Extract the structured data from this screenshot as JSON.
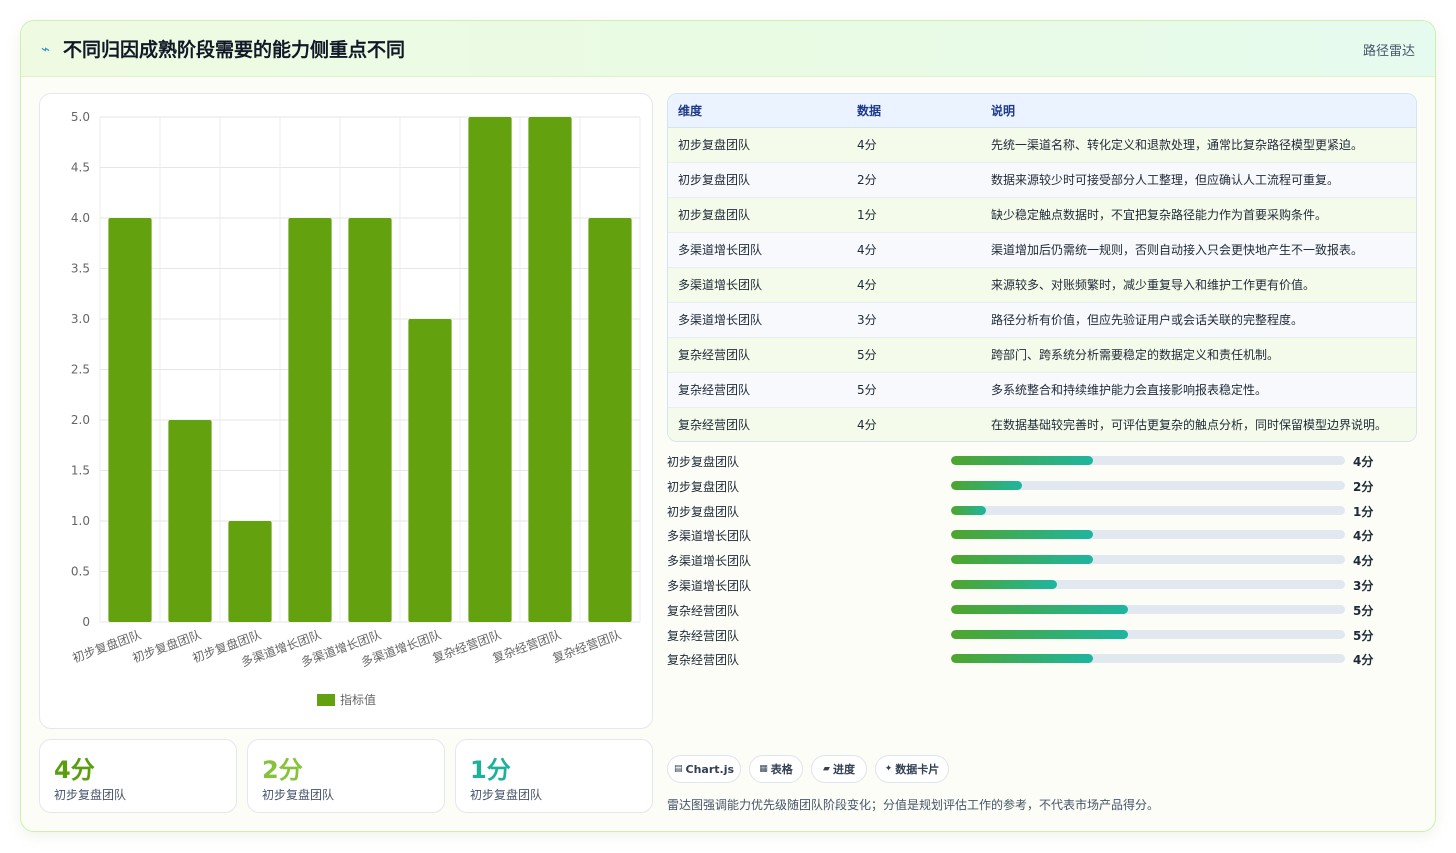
{
  "header": {
    "icon": "lightning-icon",
    "title": "不同归因成熟阶段需要的能力侧重点不同",
    "right_label": "路径雷达"
  },
  "chart_data": {
    "type": "bar",
    "categories": [
      "初步复盘团队",
      "初步复盘团队",
      "初步复盘团队",
      "多渠道增长团队",
      "多渠道增长团队",
      "多渠道增长团队",
      "复杂经营团队",
      "复杂经营团队",
      "复杂经营团队"
    ],
    "series": [
      {
        "name": "指标值",
        "values": [
          4,
          2,
          1,
          4,
          4,
          3,
          5,
          5,
          4
        ],
        "color": "#64a10f"
      }
    ],
    "ylim": [
      0,
      5
    ],
    "yticks": [
      "0",
      "0.5",
      "1.0",
      "1.5",
      "2.0",
      "2.5",
      "3.0",
      "3.5",
      "4.0",
      "4.5",
      "5.0"
    ],
    "legend": "bottom",
    "grid": true
  },
  "stats": [
    {
      "value": "4分",
      "label": "初步复盘团队",
      "color": "#5a9e0d"
    },
    {
      "value": "2分",
      "label": "初步复盘团队",
      "color": "#86c33a"
    },
    {
      "value": "1分",
      "label": "初步复盘团队",
      "color": "#1cb29a"
    }
  ],
  "table": {
    "headers": [
      "维度",
      "数据",
      "说明"
    ],
    "rows": [
      [
        "初步复盘团队",
        "4分",
        "先统一渠道名称、转化定义和退款处理，通常比复杂路径模型更紧迫。"
      ],
      [
        "初步复盘团队",
        "2分",
        "数据来源较少时可接受部分人工整理，但应确认人工流程可重复。"
      ],
      [
        "初步复盘团队",
        "1分",
        "缺少稳定触点数据时，不宜把复杂路径能力作为首要采购条件。"
      ],
      [
        "多渠道增长团队",
        "4分",
        "渠道增加后仍需统一规则，否则自动接入只会更快地产生不一致报表。"
      ],
      [
        "多渠道增长团队",
        "4分",
        "来源较多、对账频繁时，减少重复导入和维护工作更有价值。"
      ],
      [
        "多渠道增长团队",
        "3分",
        "路径分析有价值，但应先验证用户或会话关联的完整程度。"
      ],
      [
        "复杂经营团队",
        "5分",
        "跨部门、跨系统分析需要稳定的数据定义和责任机制。"
      ],
      [
        "复杂经营团队",
        "5分",
        "多系统整合和持续维护能力会直接影响报表稳定性。"
      ],
      [
        "复杂经营团队",
        "4分",
        "在数据基础较完善时，可评估更复杂的触点分析，同时保留模型边界说明。"
      ]
    ]
  },
  "progress": [
    {
      "label": "初步复盘团队",
      "value": "4分",
      "fraction": 0.36
    },
    {
      "label": "初步复盘团队",
      "value": "2分",
      "fraction": 0.18
    },
    {
      "label": "初步复盘团队",
      "value": "1分",
      "fraction": 0.09
    },
    {
      "label": "多渠道增长团队",
      "value": "4分",
      "fraction": 0.36
    },
    {
      "label": "多渠道增长团队",
      "value": "4分",
      "fraction": 0.36
    },
    {
      "label": "多渠道增长团队",
      "value": "3分",
      "fraction": 0.27
    },
    {
      "label": "复杂经营团队",
      "value": "5分",
      "fraction": 0.45
    },
    {
      "label": "复杂经营团队",
      "value": "5分",
      "fraction": 0.45
    },
    {
      "label": "复杂经营团队",
      "value": "4分",
      "fraction": 0.36
    }
  ],
  "chips": [
    {
      "icon": "chart-icon",
      "glyph": "▤",
      "label": "Chart.js"
    },
    {
      "icon": "table-icon",
      "glyph": "▦",
      "label": "表格"
    },
    {
      "icon": "progress-icon",
      "glyph": "▰",
      "label": "进度"
    },
    {
      "icon": "sparkle-icon",
      "glyph": "✦",
      "label": "数据卡片"
    }
  ],
  "footnote": "雷达图强调能力优先级随团队阶段变化；分值是规划评估工作的参考，不代表市场产品得分。"
}
